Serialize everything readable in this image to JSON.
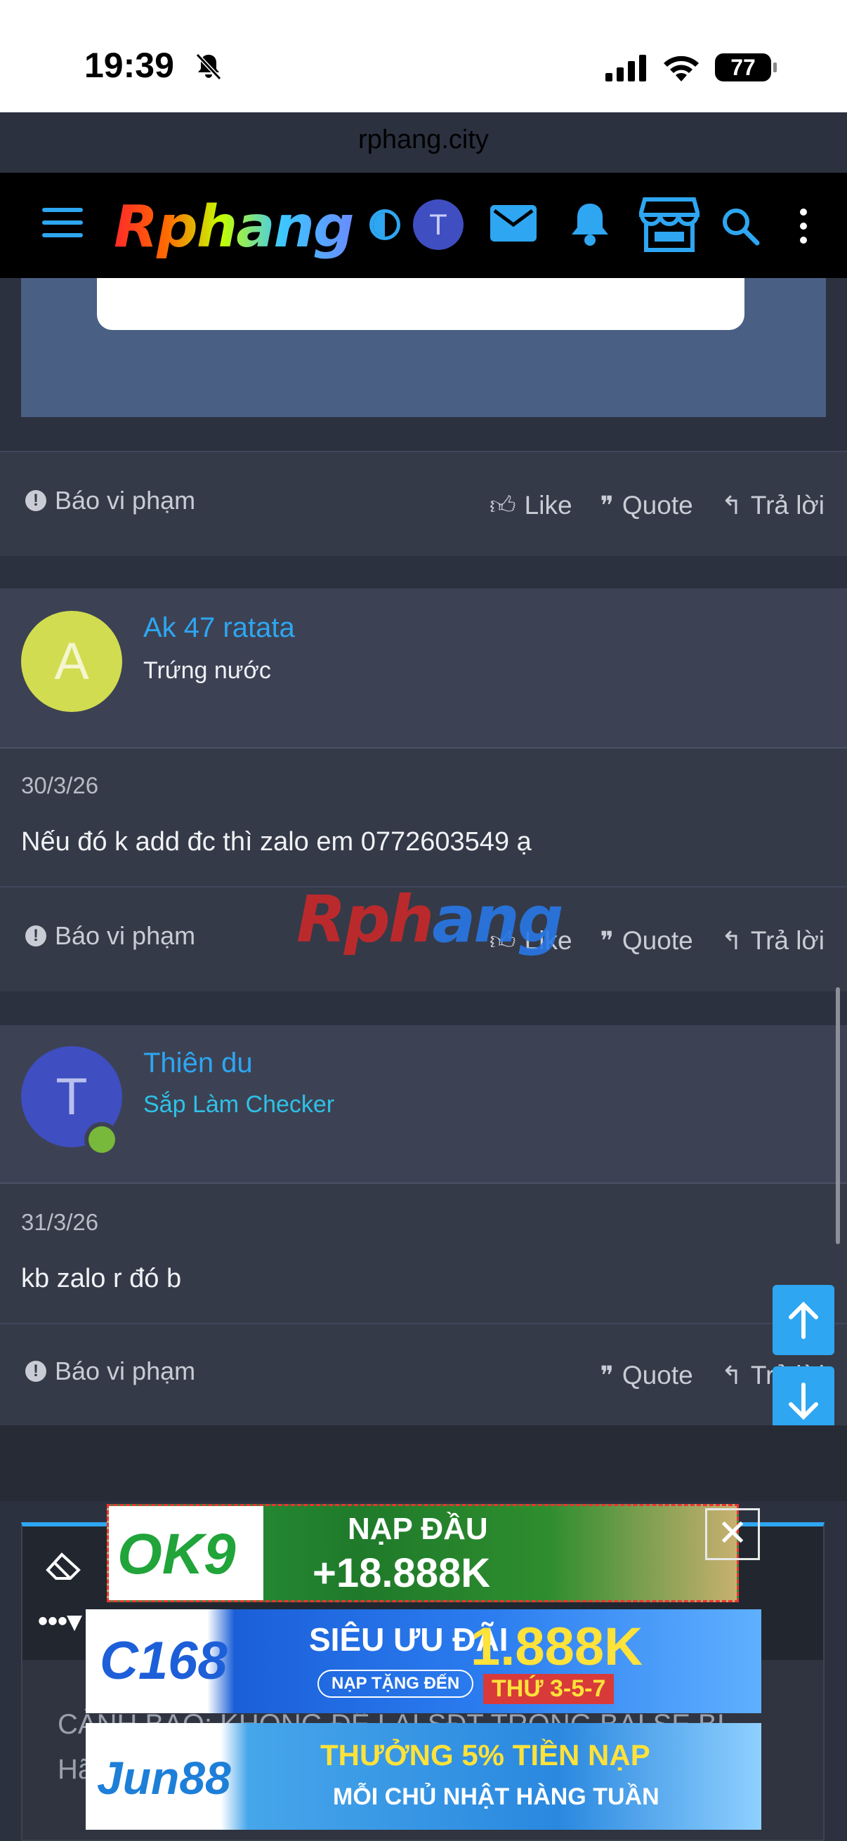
{
  "status_bar": {
    "time": "19:39",
    "battery": "77"
  },
  "browser": {
    "url": "rphang.city"
  },
  "header": {
    "logo": "Rphang",
    "avatar_letter": "T"
  },
  "post_actions": {
    "report": "Báo vi phạm",
    "like": "Like",
    "quote": "Quote",
    "reply": "Trả lời"
  },
  "posts": [
    {
      "avatar_letter": "A",
      "username": "Ak 47 ratata",
      "user_title": "Trứng nước",
      "date": "30/3/26",
      "message": "Nếu đó k add đc thì zalo em 0772603549 ạ"
    },
    {
      "avatar_letter": "T",
      "username": "Thiên du",
      "user_title": "Sắp Làm Checker",
      "date": "31/3/26",
      "message": "kb zalo r đó b"
    }
  ],
  "watermark": {
    "part1": "Rph",
    "part2": "ang"
  },
  "editor": {
    "placeholder_text": "CẢNH BÁO: KHÔNG ĐỂ LẠI SĐT TRONG BÀI SẼ BỊ ... Hã..."
  },
  "ads": [
    {
      "brand": "OK9",
      "line1": "NẠP ĐẦU",
      "line2": "+18.888K"
    },
    {
      "brand": "C168",
      "line1": "SIÊU ƯU ĐÃI",
      "line2": "1.888K",
      "tag": "NẠP TẶNG ĐẾN",
      "days": "THỨ 3-5-7"
    },
    {
      "brand": "Jun88",
      "line1": "THƯỞNG 5% TIỀN NẠP",
      "line2": "MỖI CHỦ NHẬT HÀNG TUẦN"
    }
  ],
  "colors": {
    "accent": "#2ea6f2",
    "background": "#2c3140",
    "username": "#2ea6f2",
    "title_cyan": "#2fc1e6"
  }
}
